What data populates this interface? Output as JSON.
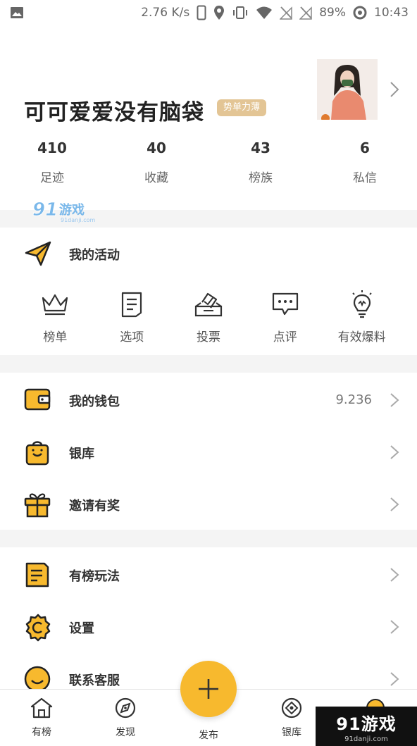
{
  "status_bar": {
    "speed": "2.76 K/s",
    "battery": "89%",
    "time": "10:43"
  },
  "profile": {
    "name": "可可爱爱没有脑袋",
    "badge": "势单力薄",
    "stats": [
      {
        "value": "410",
        "label": "足迹"
      },
      {
        "value": "40",
        "label": "收藏"
      },
      {
        "value": "43",
        "label": "榜族"
      },
      {
        "value": "6",
        "label": "私信"
      }
    ]
  },
  "watermark_top": {
    "main": "91游戏",
    "sub": "91danji.com"
  },
  "activity": {
    "title": "我的活动",
    "items": [
      {
        "label": "榜单",
        "icon": "crown-icon"
      },
      {
        "label": "选项",
        "icon": "list-doc-icon"
      },
      {
        "label": "投票",
        "icon": "ballot-box-icon"
      },
      {
        "label": "点评",
        "icon": "comment-bubble-icon"
      },
      {
        "label": "有效爆料",
        "icon": "lightbulb-icon"
      }
    ]
  },
  "menu": {
    "wallet": {
      "label": "我的钱包",
      "value": "9.236"
    },
    "bank": {
      "label": "银库"
    },
    "invite": {
      "label": "邀请有奖"
    },
    "rules": {
      "label": "有榜玩法"
    },
    "settings": {
      "label": "设置"
    },
    "support": {
      "label": "联系客服"
    }
  },
  "bottom_nav": {
    "home": "有榜",
    "discover": "发现",
    "publish": "发布",
    "bank": "银库"
  },
  "watermark_bottom": {
    "main": "91游戏",
    "sub": "91danji.com"
  },
  "colors": {
    "accent": "#f7b92e",
    "badge": "#e3c595",
    "divider": "#f4f4f4"
  }
}
